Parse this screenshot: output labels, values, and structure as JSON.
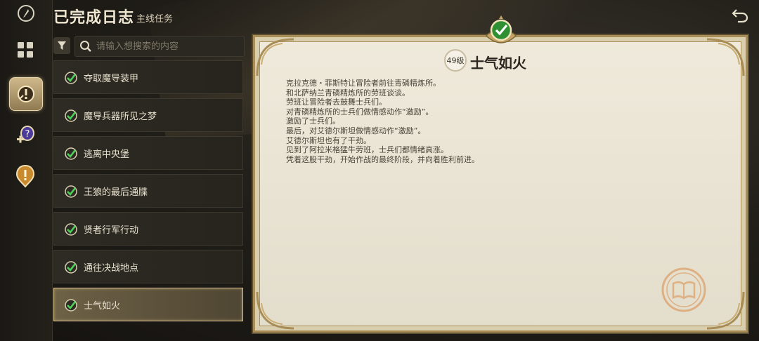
{
  "header": {
    "title": "已完成日志",
    "subtitle": "主线任务"
  },
  "search": {
    "placeholder": "请输入想搜索的内容"
  },
  "quests": [
    {
      "label": "夺取魔导装甲",
      "selected": false
    },
    {
      "label": "魔导兵器所见之梦",
      "selected": false
    },
    {
      "label": "逃离中央堡",
      "selected": false
    },
    {
      "label": "王狼的最后通牒",
      "selected": false
    },
    {
      "label": "贤者行军行动",
      "selected": false
    },
    {
      "label": "通往决战地点",
      "selected": false
    },
    {
      "label": "士气如火",
      "selected": true
    }
  ],
  "detail": {
    "level": "49级",
    "title": "士气如火",
    "lines": [
      "克拉克德・菲斯特让冒险者前往青磷精炼所。",
      "和北萨纳兰青磷精炼所的劳班谈谈。",
      "劳班让冒险者去鼓舞士兵们。",
      "对青磷精炼所的士兵们做情感动作“激励”。",
      "激励了士兵们。",
      "最后，对艾德尔斯坦做情感动作“激励”。",
      "艾德尔斯坦也有了干劲。",
      "见到了阿拉米格猛牛劳班，士兵们都情绪高涨。",
      "凭着这股干劲，开始作战的最终阶段，并向着胜利前进。"
    ]
  },
  "icons": {
    "logo": "quill-logo-icon",
    "grid": "grid-menu-icon",
    "completed": "completed-quest-icon",
    "add_quest": "add-quest-icon",
    "quest": "quest-marker-icon",
    "back": "back-arrow-icon",
    "filter": "filter-icon",
    "search": "search-icon",
    "check": "check-icon"
  },
  "colors": {
    "accent_gold": "#d8c38f",
    "check_green": "#3cb043",
    "parchment": "#ece7d8"
  }
}
